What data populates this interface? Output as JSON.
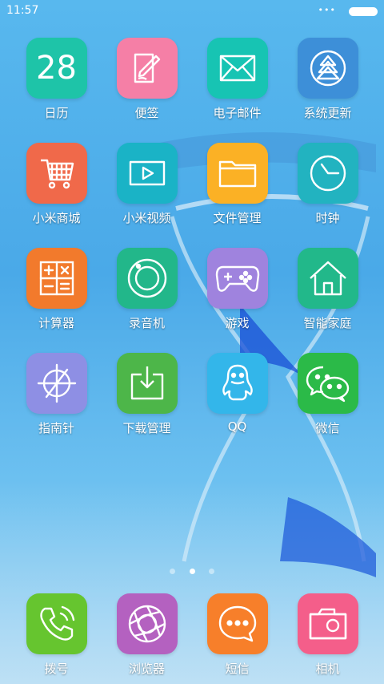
{
  "status_bar": {
    "time": "11:57",
    "dots": "•••"
  },
  "calendar_date": "28",
  "apps": [
    {
      "label": "日历",
      "icon": "calendar-icon",
      "color": "#1ec4a8"
    },
    {
      "label": "便签",
      "icon": "notes-icon",
      "color": "#f57fa6"
    },
    {
      "label": "电子邮件",
      "icon": "mail-icon",
      "color": "#17c4b3"
    },
    {
      "label": "系统更新",
      "icon": "update-icon",
      "color": "#3d8fd8"
    },
    {
      "label": "小米商城",
      "icon": "cart-icon",
      "color": "#f0694a"
    },
    {
      "label": "小米视频",
      "icon": "video-icon",
      "color": "#1ab3c6"
    },
    {
      "label": "文件管理",
      "icon": "folder-icon",
      "color": "#fbb125"
    },
    {
      "label": "时钟",
      "icon": "clock-icon",
      "color": "#22b3c0"
    },
    {
      "label": "计算器",
      "icon": "calculator-icon",
      "color": "#f27a2c"
    },
    {
      "label": "录音机",
      "icon": "recorder-icon",
      "color": "#22b78a"
    },
    {
      "label": "游戏",
      "icon": "gamepad-icon",
      "color": "#9f83de"
    },
    {
      "label": "智能家庭",
      "icon": "home-icon",
      "color": "#22b88a"
    },
    {
      "label": "指南针",
      "icon": "compass-icon",
      "color": "#8e8fe4"
    },
    {
      "label": "下载管理",
      "icon": "download-icon",
      "color": "#4db649"
    },
    {
      "label": "QQ",
      "icon": "qq-icon",
      "color": "#33b6ea"
    },
    {
      "label": "微信",
      "icon": "wechat-icon",
      "color": "#2bba48"
    }
  ],
  "page_indicator": {
    "pages": 3,
    "current": 2
  },
  "dock": [
    {
      "label": "拨号",
      "icon": "phone-icon",
      "color": "#66c52f"
    },
    {
      "label": "浏览器",
      "icon": "browser-icon",
      "color": "#b461c0"
    },
    {
      "label": "短信",
      "icon": "sms-icon",
      "color": "#f77f2a"
    },
    {
      "label": "相机",
      "icon": "camera-icon",
      "color": "#f45e8a"
    }
  ]
}
